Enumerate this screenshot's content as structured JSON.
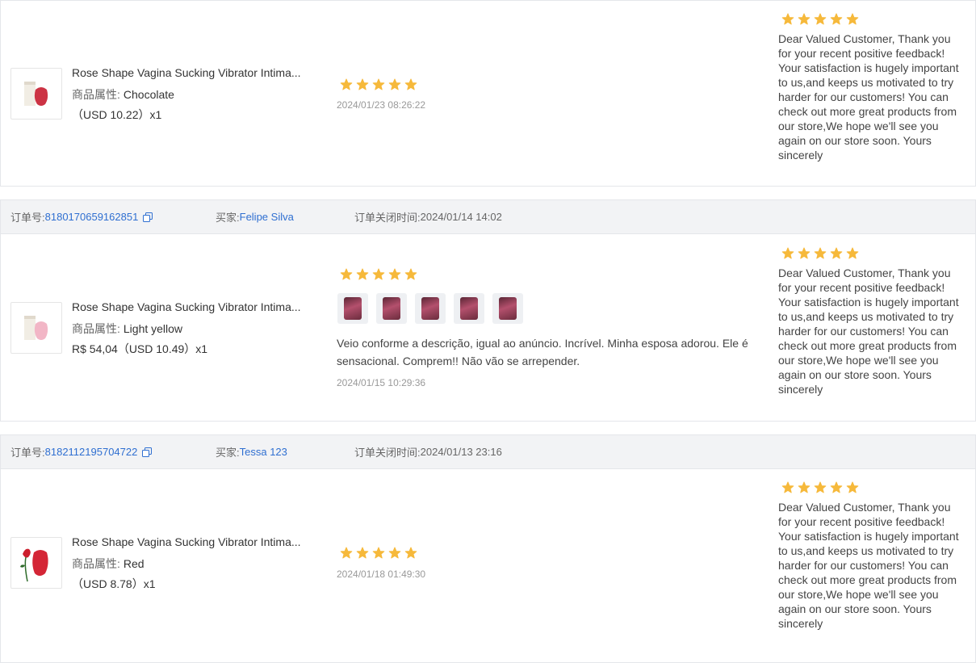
{
  "colors": {
    "star": "#f6b93b",
    "link": "#2f6fd1",
    "header_bg": "#f2f3f5"
  },
  "header_labels": {
    "order_no": "订单号:",
    "buyer": "买家:",
    "closed_time": "订单关闭时间:"
  },
  "orders": [
    {
      "product": {
        "title": "Rose Shape Vagina Sucking Vibrator Intima...",
        "attr_label": "商品属性:",
        "attr_value": "Chocolate",
        "price": "（USD  10.22）x1",
        "image_icon": "rose-vibrator-white-box"
      },
      "review": {
        "stars": 5,
        "date": "2024/01/23 08:26:22"
      },
      "seller_reply": {
        "stars": 5,
        "text": "Dear Valued Customer, Thank you for your recent positive feedback! Your satisfaction is hugely important to us,and keeps us motivated to try harder for our customers! You can check out more great products from our store,We hope we'll see you again on our store soon. Yours sincerely"
      }
    },
    {
      "order_no": "8180170659162851",
      "buyer": "Felipe Silva",
      "closed_time": "2024/01/14 14:02",
      "product": {
        "title": "Rose Shape Vagina Sucking Vibrator Intima...",
        "attr_label": "商品属性:",
        "attr_value": "Light yellow",
        "price": "R$ 54,04（USD  10.49）x1",
        "image_icon": "rose-vibrator-pink-box"
      },
      "review": {
        "stars": 5,
        "photos": 5,
        "text": "Veio conforme a descrição, igual ao anúncio. Incrível. Minha esposa adorou. Ele é sensacional. Comprem!! Não vão se arrepender.",
        "date": "2024/01/15 10:29:36"
      },
      "seller_reply": {
        "stars": 5,
        "text": "Dear Valued Customer, Thank you for your recent positive feedback! Your satisfaction is hugely important to us,and keeps us motivated to try harder for our customers! You can check out more great products from our store,We hope we'll see you again on our store soon. Yours sincerely"
      }
    },
    {
      "order_no": "8182112195704722",
      "buyer": "Tessa 123",
      "closed_time": "2024/01/13 23:16",
      "product": {
        "title": "Rose Shape Vagina Sucking Vibrator Intima...",
        "attr_label": "商品属性:",
        "attr_value": "Red",
        "price": "（USD  8.78）x1",
        "image_icon": "rose-vibrator-red"
      },
      "review": {
        "stars": 5,
        "date": "2024/01/18 01:49:30"
      },
      "seller_reply": {
        "stars": 5,
        "text": "Dear Valued Customer, Thank you for your recent positive feedback! Your satisfaction is hugely important to us,and keeps us motivated to try harder for our customers! You can check out more great products from our store,We hope we'll see you again on our store soon. Yours sincerely"
      }
    }
  ]
}
